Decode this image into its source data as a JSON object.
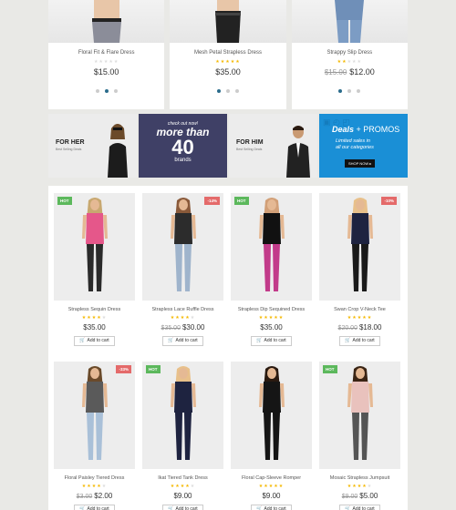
{
  "top_products": [
    {
      "name": "Floral Fit & Flare Dress",
      "price": "$15.00",
      "old_price": "",
      "rating": 0,
      "active_dot": 1
    },
    {
      "name": "Mesh Petal Strapless Dress",
      "price": "$35.00",
      "old_price": "",
      "rating": 5,
      "active_dot": 0
    },
    {
      "name": "Strappy Slip Dress",
      "price": "$12.00",
      "old_price": "$15.00",
      "rating": 2,
      "active_dot": 0
    }
  ],
  "banners": {
    "her": {
      "title": "FOR HER",
      "sub": "Best Selling Deals"
    },
    "more": {
      "line1": "check out now!",
      "line2": "more than",
      "line3": "40",
      "line4": "brands"
    },
    "him": {
      "title": "FOR HIM",
      "sub": "Best Selling Deals"
    },
    "deals": {
      "title_bold": "Deals",
      "title_rest": " + PROMOS",
      "line1": "Limited sales in",
      "line2": "all our categories",
      "button": "SHOP NOW ▸"
    }
  },
  "products": [
    {
      "name": "Strapless Sequin Dress",
      "price": "$35.00",
      "old_price": "",
      "rating": 4,
      "badge": "HOT",
      "badge_type": "hot",
      "button": "Add to cart"
    },
    {
      "name": "Strapless Lace Ruffle Dress",
      "price": "$30.00",
      "old_price": "$35.00",
      "rating": 4,
      "badge": "-14%",
      "badge_type": "sale",
      "button": "Add to cart"
    },
    {
      "name": "Strapless Dip Sequined Dress",
      "price": "$35.00",
      "old_price": "",
      "rating": 5,
      "badge": "HOT",
      "badge_type": "hot",
      "button": "Add to cart"
    },
    {
      "name": "Swan Crop V-Neck Tee",
      "price": "$18.00",
      "old_price": "$20.00",
      "rating": 5,
      "badge": "-10%",
      "badge_type": "sale",
      "button": "Add to cart"
    },
    {
      "name": "Floral Paisley Tiered Dress",
      "price": "$2.00",
      "old_price": "$3.00",
      "rating": 4,
      "badge": "-33%",
      "badge_type": "sale",
      "button": "Add to cart"
    },
    {
      "name": "Ikat Tiered Tank Dress",
      "price": "$9.00",
      "old_price": "",
      "rating": 4,
      "badge": "HOT",
      "badge_type": "hot",
      "button": "Add to cart"
    },
    {
      "name": "Floral Cap-Sleeve Romper",
      "price": "$9.00",
      "old_price": "",
      "rating": 5,
      "badge": "",
      "badge_type": "",
      "button": "Add to cart"
    },
    {
      "name": "Mosaic Strapless Jumpsuit",
      "price": "$5.00",
      "old_price": "$9.00",
      "rating": 4,
      "badge": "HOT",
      "badge_type": "hot",
      "button": "Add to cart"
    }
  ],
  "colors": {
    "hot": "#5cb85c",
    "sale": "#e46a6a",
    "star": "#f5b800",
    "deals_blue": "#1a8fd6",
    "brands_navy": "#3f4066",
    "dot_active": "#2b6c8c"
  }
}
